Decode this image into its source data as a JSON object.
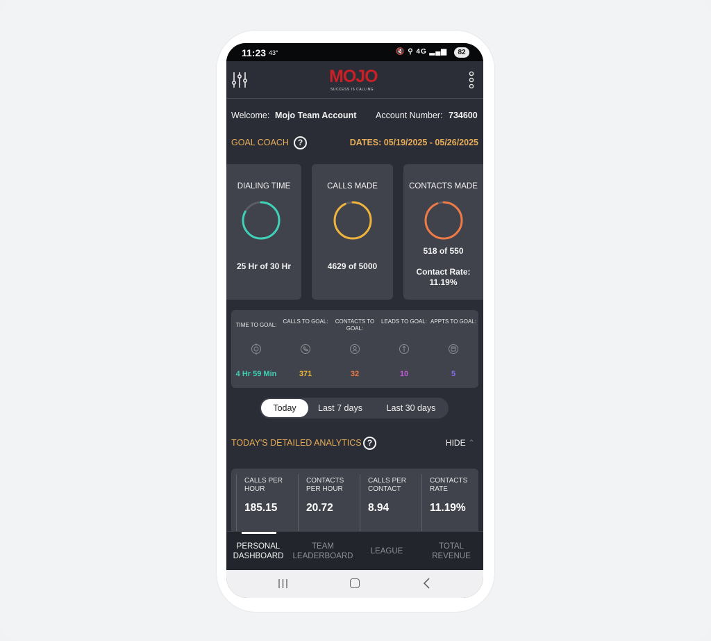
{
  "status_bar": {
    "time": "11:23",
    "temp": "43°",
    "network": "4G",
    "battery": "82"
  },
  "header": {
    "logo_text": "MOJO",
    "logo_tagline": "SUCCESS IS CALLING"
  },
  "welcome": {
    "label": "Welcome:",
    "name": "Mojo Team Account",
    "account_label": "Account Number:",
    "account_number": "734600"
  },
  "goal_coach": {
    "label": "GOAL COACH",
    "help": "?",
    "dates": "DATES: 05/19/2025 - 05/26/2025"
  },
  "cards": [
    {
      "title": "DIALING TIME",
      "value": "25 Hr of 30 Hr",
      "progress": 0.83,
      "color": "#3fd1b8"
    },
    {
      "title": "CALLS MADE",
      "value": "4629 of 5000",
      "progress": 0.93,
      "color": "#f0b43c"
    },
    {
      "title": "CONTACTS MADE",
      "value": "518 of 550",
      "progress": 0.94,
      "color": "#ef7a45",
      "rate_label": "Contact Rate:",
      "rate_value": "11.19%"
    }
  ],
  "to_goal": [
    {
      "title": "TIME TO GOAL:",
      "value": "4 Hr 59 Min",
      "color": "#3fd1b8",
      "icon": "target-icon"
    },
    {
      "title": "CALLS TO GOAL:",
      "value": "371",
      "color": "#f0b43c",
      "icon": "phone-icon"
    },
    {
      "title": "CONTACTS TO GOAL:",
      "value": "32",
      "color": "#ef7a45",
      "icon": "contact-icon"
    },
    {
      "title": "LEADS TO GOAL:",
      "value": "10",
      "color": "#c25bdc",
      "icon": "lead-icon"
    },
    {
      "title": "APPTS TO GOAL:",
      "value": "5",
      "color": "#8a6ef0",
      "icon": "calendar-icon"
    }
  ],
  "range_tabs": {
    "today": "Today",
    "last7": "Last 7 days",
    "last30": "Last 30 days"
  },
  "analytics": {
    "title": "TODAY'S DETAILED ANALYTICS",
    "hide": "HIDE",
    "metrics": [
      {
        "label1": "CALLS PER",
        "label2": "HOUR",
        "value": "185.15"
      },
      {
        "label1": "CONTACTS",
        "label2": "PER HOUR",
        "value": "20.72"
      },
      {
        "label1": "CALLS PER",
        "label2": "CONTACT",
        "value": "8.94"
      },
      {
        "label1": "CONTACTS",
        "label2": "RATE",
        "value": "11.19%"
      }
    ]
  },
  "bottom_nav": [
    {
      "line1": "PERSONAL",
      "line2": "DASHBOARD"
    },
    {
      "line1": "TEAM",
      "line2": "LEADERBOARD"
    },
    {
      "line1": "LEAGUE",
      "line2": ""
    },
    {
      "line1": "TOTAL",
      "line2": "REVENUE"
    }
  ]
}
